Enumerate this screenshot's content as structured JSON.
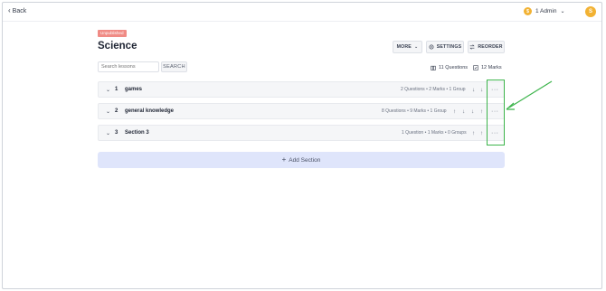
{
  "header": {
    "back_label": "Back",
    "admin_coin_text": "$",
    "admin_label": "1 Admin",
    "avatar_initial": "S"
  },
  "course": {
    "status_badge": "Unpublished",
    "title": "Science"
  },
  "toolbar": {
    "more_label": "MORE",
    "settings_label": "SETTINGS",
    "reorder_label": "REORDER"
  },
  "search": {
    "placeholder": "Search lessons",
    "button_label": "SEARCH"
  },
  "summary": {
    "questions": "11 Questions",
    "marks": "12 Marks"
  },
  "sections": [
    {
      "number": "1",
      "name": "games",
      "meta": "2 Questions • 2 Marks • 1 Group"
    },
    {
      "number": "2",
      "name": "general knowledge",
      "meta": "8 Questions • 9 Marks • 1 Group"
    },
    {
      "number": "3",
      "name": "Section 3",
      "meta": "1 Question • 1 Marks • 0 Groups"
    }
  ],
  "add_section_label": "Add Section",
  "icons": {
    "caret": "chevron-down-icon",
    "up": "arrow-up-icon",
    "down": "arrow-down-icon",
    "more": "ellipsis-icon"
  },
  "colors": {
    "badge": "#f08b85",
    "accent_coin": "#f2b233",
    "add_section_bg": "#dfe5fb",
    "annotation": "#3cb44b"
  }
}
